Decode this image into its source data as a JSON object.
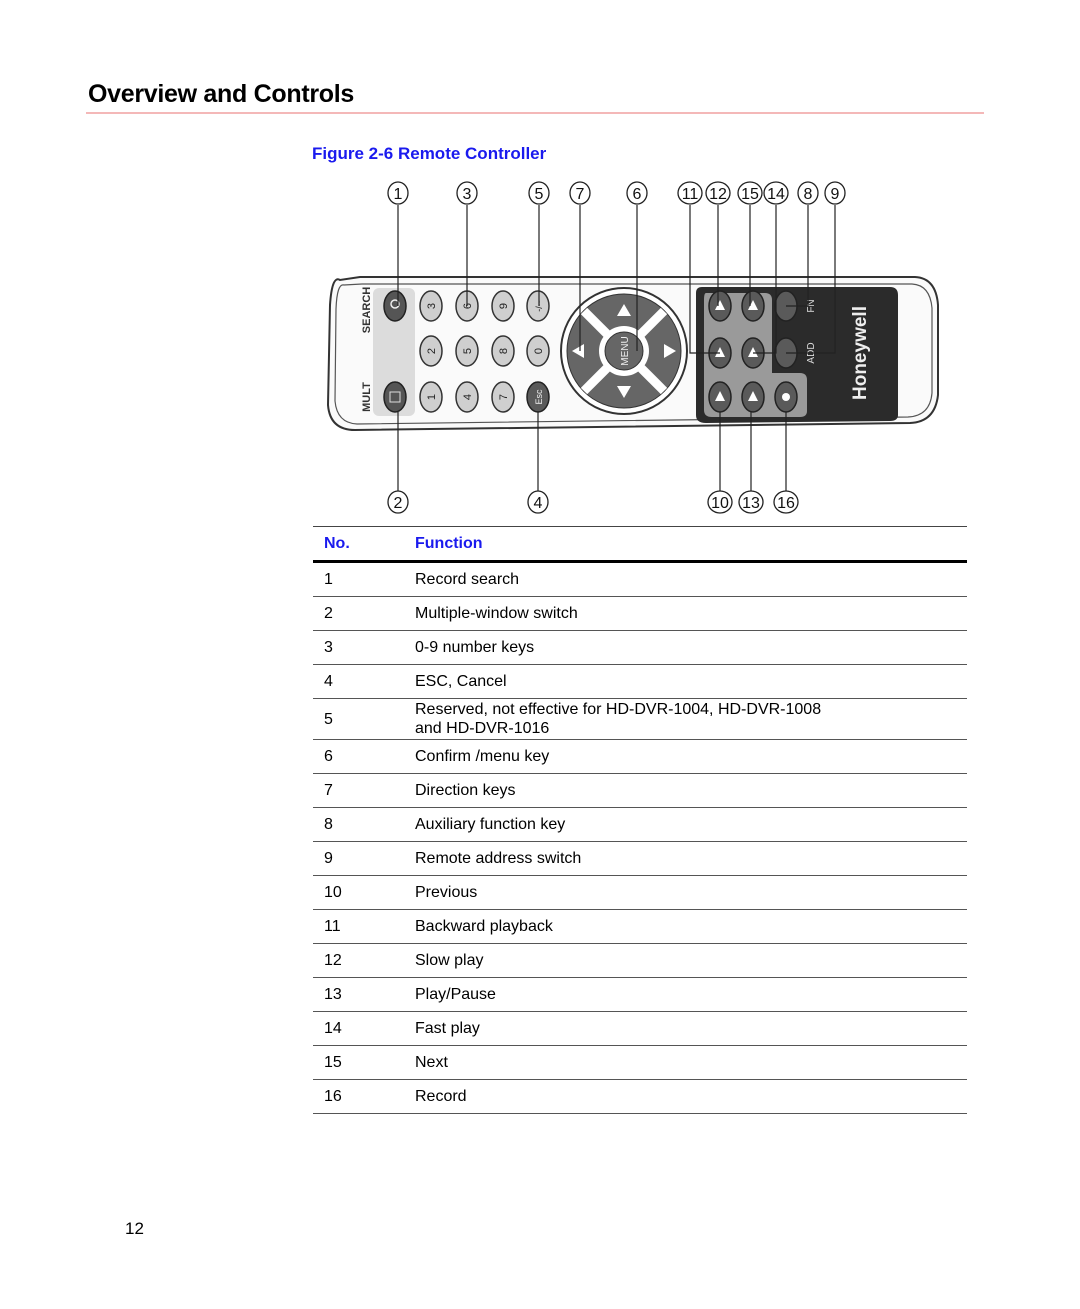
{
  "page": {
    "section_title": "Overview and Controls",
    "figure_caption": "Figure 2-6 Remote Controller",
    "page_number": "12"
  },
  "colors": {
    "caption_blue": "#1a1aee",
    "title_rule": "#f4b8b8"
  },
  "figure": {
    "callouts_top": [
      "1",
      "3",
      "5",
      "7",
      "6",
      "11",
      "12",
      "15",
      "14",
      "8",
      "9"
    ],
    "callouts_bottom": [
      "2",
      "4",
      "10",
      "13",
      "16"
    ],
    "remote_labels": {
      "search": "SEARCH",
      "mult": "MULT",
      "menu": "MENU",
      "esc": "Esc",
      "fn": "FN",
      "add": "ADD",
      "brand": "Honeywell",
      "dash_key": "-/--"
    },
    "number_keys": [
      "3",
      "6",
      "9",
      "2",
      "5",
      "8",
      "0",
      "1",
      "4",
      "7"
    ]
  },
  "table": {
    "headers": {
      "no": "No.",
      "function": "Function"
    },
    "rows": [
      {
        "no": "1",
        "function": "Record search"
      },
      {
        "no": "2",
        "function": "Multiple-window switch"
      },
      {
        "no": "3",
        "function": "0-9 number keys"
      },
      {
        "no": "4",
        "function": "ESC, Cancel"
      },
      {
        "no": "5",
        "function": "Reserved, not effective for HD-DVR-1004, HD-DVR-1008",
        "function_line2": "and HD-DVR-1016"
      },
      {
        "no": "6",
        "function": "Confirm /menu key"
      },
      {
        "no": "7",
        "function": "Direction keys"
      },
      {
        "no": "8",
        "function": "Auxiliary function key"
      },
      {
        "no": "9",
        "function": "Remote address switch"
      },
      {
        "no": "10",
        "function": "Previous"
      },
      {
        "no": "11",
        "function": "Backward playback"
      },
      {
        "no": "12",
        "function": "Slow play"
      },
      {
        "no": "13",
        "function": "Play/Pause"
      },
      {
        "no": "14",
        "function": "Fast play"
      },
      {
        "no": "15",
        "function": "Next"
      },
      {
        "no": "16",
        "function": "Record"
      }
    ]
  }
}
